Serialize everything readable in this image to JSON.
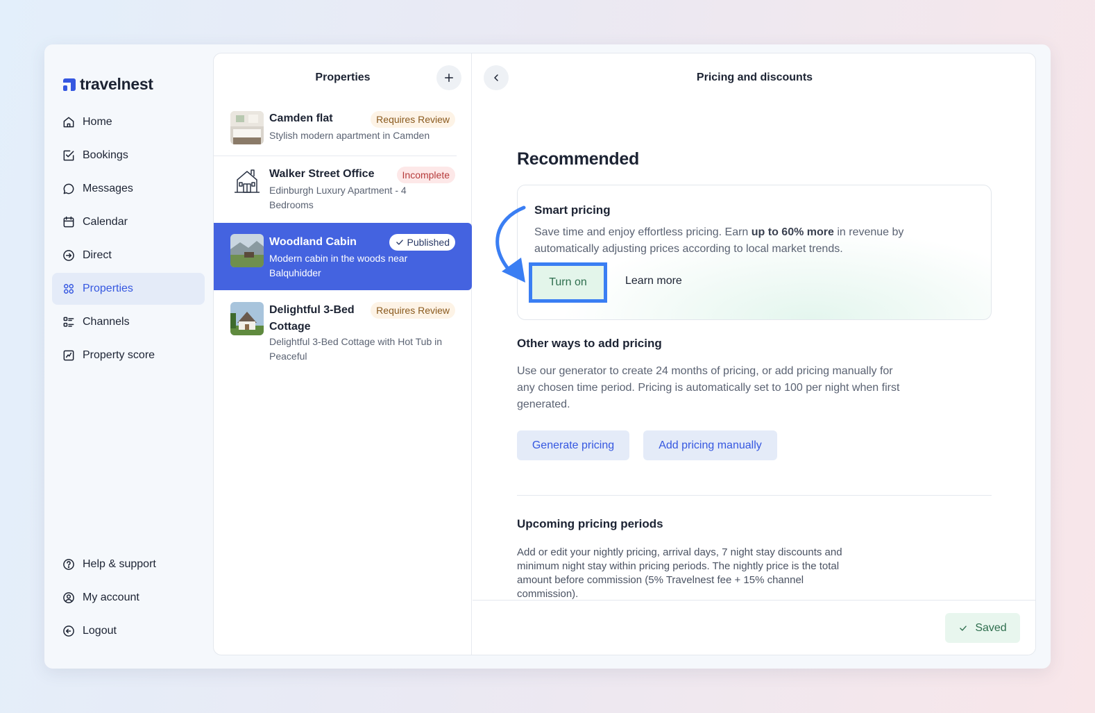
{
  "brand": {
    "name": "travelnest",
    "color": "#3557e0"
  },
  "nav": {
    "items": [
      {
        "label": "Home",
        "icon": "home-icon"
      },
      {
        "label": "Bookings",
        "icon": "checkbox-icon"
      },
      {
        "label": "Messages",
        "icon": "chat-bubble-icon"
      },
      {
        "label": "Calendar",
        "icon": "calendar-icon"
      },
      {
        "label": "Direct",
        "icon": "arrow-circle-icon"
      },
      {
        "label": "Properties",
        "icon": "grid-icon",
        "active": true
      },
      {
        "label": "Channels",
        "icon": "list-icon"
      },
      {
        "label": "Property score",
        "icon": "chart-icon"
      }
    ],
    "bottom": [
      {
        "label": "Help & support",
        "icon": "help-icon"
      },
      {
        "label": "My account",
        "icon": "user-circle-icon"
      },
      {
        "label": "Logout",
        "icon": "logout-icon"
      }
    ]
  },
  "properties": {
    "title": "Properties",
    "add_icon": "plus-icon",
    "items": [
      {
        "name": "Camden flat",
        "desc": "Stylish modern apartment in Camden",
        "badge": "Requires Review",
        "badge_type": "review"
      },
      {
        "name": "Walker Street Office",
        "desc": "Edinburgh Luxury Apartment - 4 Bedrooms",
        "badge": "Incomplete",
        "badge_type": "incomplete"
      },
      {
        "name": "Woodland Cabin",
        "desc": "Modern cabin in the woods near Balquhidder",
        "badge": "Published",
        "badge_type": "published",
        "selected": true
      },
      {
        "name": "Delightful 3-Bed Cottage",
        "desc": "Delightful 3-Bed Cottage with Hot Tub in Peaceful",
        "badge": "Requires Review",
        "badge_type": "review"
      }
    ]
  },
  "pricing": {
    "title": "Pricing and discounts",
    "recommended_heading": "Recommended",
    "smart": {
      "title": "Smart pricing",
      "text_before": "Save time and enjoy effortless pricing. Earn ",
      "text_bold": "up to 60% more",
      "text_after": " in revenue by automatically adjusting prices according to local market trends.",
      "turn_on": "Turn on",
      "learn_more": "Learn more"
    },
    "other": {
      "heading": "Other ways to add pricing",
      "text": "Use our generator to create 24 months of pricing, or add pricing manually for any chosen time period. Pricing is automatically set to 100 per night when first generated.",
      "generate": "Generate pricing",
      "manual": "Add pricing manually"
    },
    "upcoming": {
      "heading": "Upcoming pricing periods",
      "text": "Add or edit your nightly pricing, arrival days, 7 night stay discounts and minimum night stay within pricing periods. The nightly price is the total amount before commission (5% Travelnest fee + 15% channel commission)."
    },
    "saved": "Saved"
  },
  "colors": {
    "accent": "#3557e0",
    "highlight": "#3a7ef3",
    "success": "#2e6e4e"
  }
}
